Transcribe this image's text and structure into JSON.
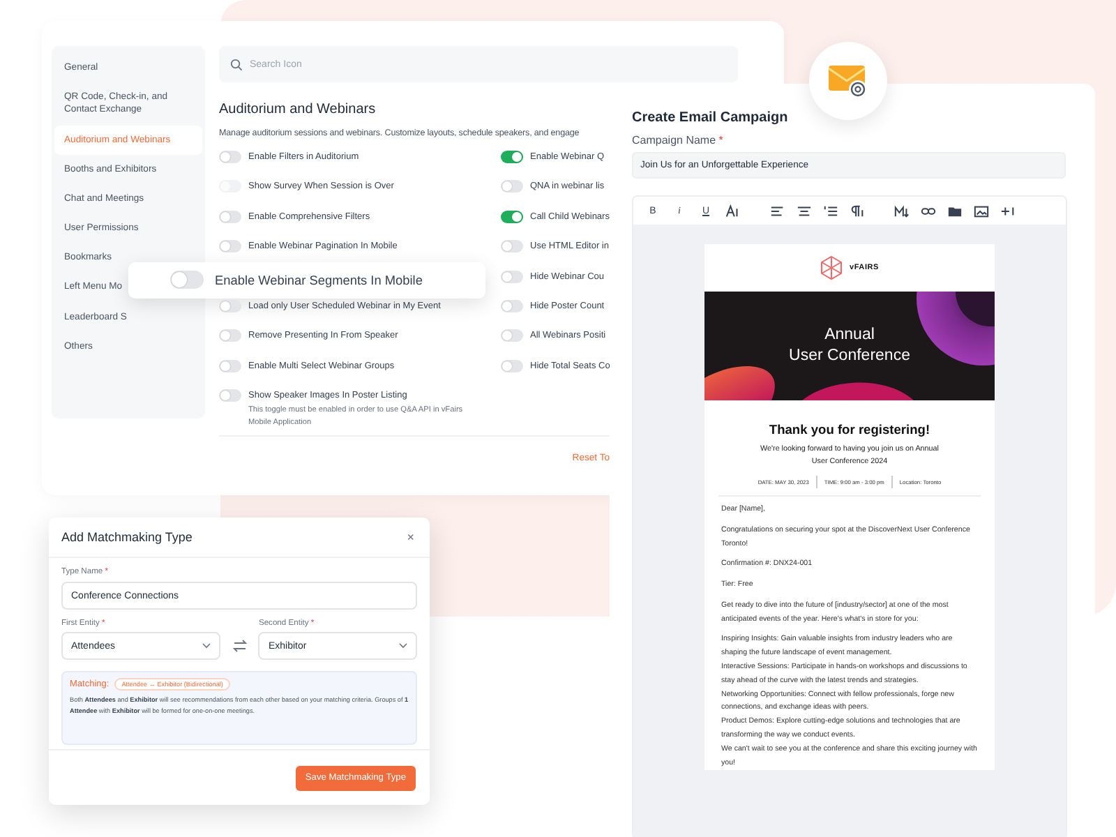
{
  "settings": {
    "sidebar": {
      "items": [
        {
          "label": "General",
          "selected": false
        },
        {
          "label": "QR Code, Check-in, and Contact Exchange",
          "selected": false
        },
        {
          "label": "Auditorium and Webinars",
          "selected": true
        },
        {
          "label": "Booths and Exhibitors",
          "selected": false
        },
        {
          "label": "Chat and Meetings",
          "selected": false
        },
        {
          "label": "User Permissions",
          "selected": false
        },
        {
          "label": "Bookmarks",
          "selected": false
        },
        {
          "label": "Left Menu Mo",
          "selected": false
        },
        {
          "label": "Leaderboard S",
          "selected": false
        },
        {
          "label": "Others",
          "selected": false
        }
      ]
    },
    "search": {
      "placeholder": "Search Icon"
    },
    "title": "Auditorium and Webinars",
    "description": "Manage auditorium sessions and webinars. Customize layouts, schedule speakers, and engage",
    "toggles_left": [
      {
        "kind": "row",
        "label": "Enable Filters in Auditorium",
        "on": false,
        "disabled": false
      },
      {
        "kind": "row",
        "label": "Show Survey When Session is Over",
        "on": false,
        "disabled": true
      },
      {
        "kind": "row",
        "label": "Enable Comprehensive Filters",
        "on": false,
        "disabled": false
      },
      {
        "kind": "row",
        "label": "Enable Webinar Pagination In Mobile",
        "on": false,
        "disabled": false
      },
      {
        "kind": "floating",
        "label": "Enable Webinar Segments In Mobile",
        "on": false,
        "disabled": false
      },
      {
        "kind": "row",
        "label": "Load only User Scheduled Webinar in My Event",
        "on": false,
        "disabled": false
      },
      {
        "kind": "row",
        "label": "Remove Presenting In From Speaker",
        "on": false,
        "disabled": false
      },
      {
        "kind": "row",
        "label": "Enable Multi Select Webinar Groups",
        "on": false,
        "disabled": false
      },
      {
        "kind": "row",
        "label": "Show Speaker Images In Poster Listing",
        "on": false,
        "disabled": false,
        "hint": "This toggle must be enabled in order to use Q&A API in vFairs Mobile Application"
      }
    ],
    "toggles_right": [
      {
        "kind": "row",
        "label": "Enable Webinar Q",
        "on": true,
        "disabled": false
      },
      {
        "kind": "row",
        "label": "QNA in webinar lis",
        "on": false,
        "disabled": false
      },
      {
        "kind": "row",
        "label": "Call Child Webinars",
        "on": true,
        "disabled": false
      },
      {
        "kind": "row",
        "label": "Use HTML Editor in",
        "on": false,
        "disabled": false
      },
      {
        "kind": "row",
        "label": "Hide Webinar Cou",
        "on": false,
        "disabled": false
      },
      {
        "kind": "row",
        "label": "Hide Poster Count",
        "on": false,
        "disabled": false
      },
      {
        "kind": "row",
        "label": "All Webinars Positi",
        "on": false,
        "disabled": false
      },
      {
        "kind": "row",
        "label": "Hide Total Seats Co",
        "on": false,
        "disabled": false
      }
    ],
    "reset_link": "Reset To"
  },
  "email_campaign": {
    "title": "Create Email Campaign",
    "campaign_name": {
      "label": "Campaign Name",
      "required_mark": "*",
      "value": "Join Us for an Unforgettable Experience"
    },
    "toolbar": {
      "text_buttons": [
        "B",
        "i",
        "U"
      ]
    },
    "email": {
      "logo_text": "vFAIRS",
      "banner_lines": [
        "Annual",
        "User Conference"
      ],
      "heading": "Thank you for registering!",
      "subheading": "We're looking forward to having you join us on Annual User Conference 2024",
      "details": [
        "DATE: MAY 30, 2023",
        "TIME: 9:00 am - 3:00 pm",
        "Location: Toronto"
      ],
      "body": [
        {
          "kind": "paragraph",
          "text": "Dear [Name],"
        },
        {
          "kind": "paragraph",
          "text": " Congratulations on securing your spot at the DiscoverNext User Conference Toronto!"
        },
        {
          "kind": "paragraph",
          "text": "Confirmation #: DNX24-001"
        },
        {
          "kind": "paragraph",
          "text": "Tier: Free"
        },
        {
          "kind": "paragraph",
          "text": "Get ready to dive into the future of [industry/sector] at one of the most anticipated events of the year. Here's what's in store for you:"
        },
        {
          "kind": "paragraph",
          "text": "Inspiring Insights: Gain valuable insights from industry leaders who are shaping the future landscape of event management."
        },
        {
          "kind": "line",
          "text": "Interactive Sessions: Participate in hands-on workshops and discussions to stay ahead of the curve with the latest trends and strategies."
        },
        {
          "kind": "line",
          "text": "Networking Opportunities: Connect with fellow professionals, forge new connections, and exchange ideas with peers."
        },
        {
          "kind": "line",
          "text": "Product Demos: Explore cutting-edge solutions and technologies that are transforming the way we conduct events."
        },
        {
          "kind": "line",
          "text": "We can't wait to see you at the conference and share this exciting journey with you!"
        }
      ]
    }
  },
  "matchmaking_dialog": {
    "title": "Add Matchmaking Type",
    "close": "×",
    "type_name": {
      "label": "Type Name",
      "required_mark": "*",
      "value": "Conference Connections"
    },
    "first_entity": {
      "label": "First Entity",
      "required_mark": "*",
      "value": "Attendees"
    },
    "second_entity": {
      "label": "Second Entity",
      "required_mark": "*",
      "value": "Exhibitor"
    },
    "matching": {
      "label": "Matching:",
      "badge": "Attendee ↔ Exhibitor (Bidirectional)",
      "text": "Both **Attendees** and **Exhibitor** will see recommendations from each other based on your matching criteria. Groups of **1 Attendee** with **Exhibitor** will be formed for one-on-one meetings."
    },
    "save_button": "Save Matchmaking Type"
  }
}
